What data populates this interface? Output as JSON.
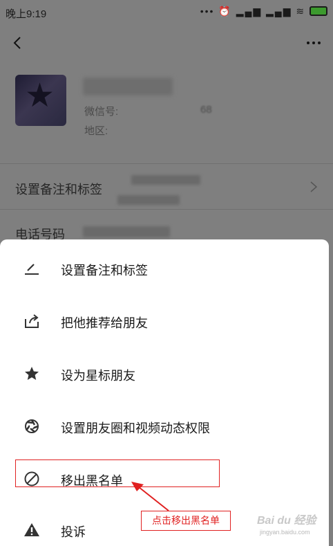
{
  "status_bar": {
    "time": "晚上9:19",
    "icons": [
      "more-dots-icon",
      "alarm-icon",
      "signal-icon",
      "signal-icon",
      "wifi-icon",
      "battery-charging-icon"
    ]
  },
  "navbar": {
    "back_icon": "chevron-left-icon",
    "more_icon": "more-horizontal-icon"
  },
  "profile": {
    "wechat_id_label": "微信号:",
    "wechat_id_suffix": "68",
    "region_label": "地区:"
  },
  "rows": {
    "remark_label": "设置备注和标签",
    "phone_label": "电话号码"
  },
  "sheet": {
    "items": [
      {
        "label": "设置备注和标签",
        "icon": "pencil-icon"
      },
      {
        "label": "把他推荐给朋友",
        "icon": "share-icon"
      },
      {
        "label": "设为星标朋友",
        "icon": "star-icon"
      },
      {
        "label": "设置朋友圈和视频动态权限",
        "icon": "aperture-icon"
      },
      {
        "label": "移出黑名单",
        "icon": "blocked-icon"
      },
      {
        "label": "投诉",
        "icon": "warning-icon"
      }
    ]
  },
  "annotation": {
    "text": "点击移出黑名单",
    "color": "#e02020"
  },
  "watermark": {
    "brand": "Bai du 经验",
    "url": "jingyan.baidu.com"
  }
}
